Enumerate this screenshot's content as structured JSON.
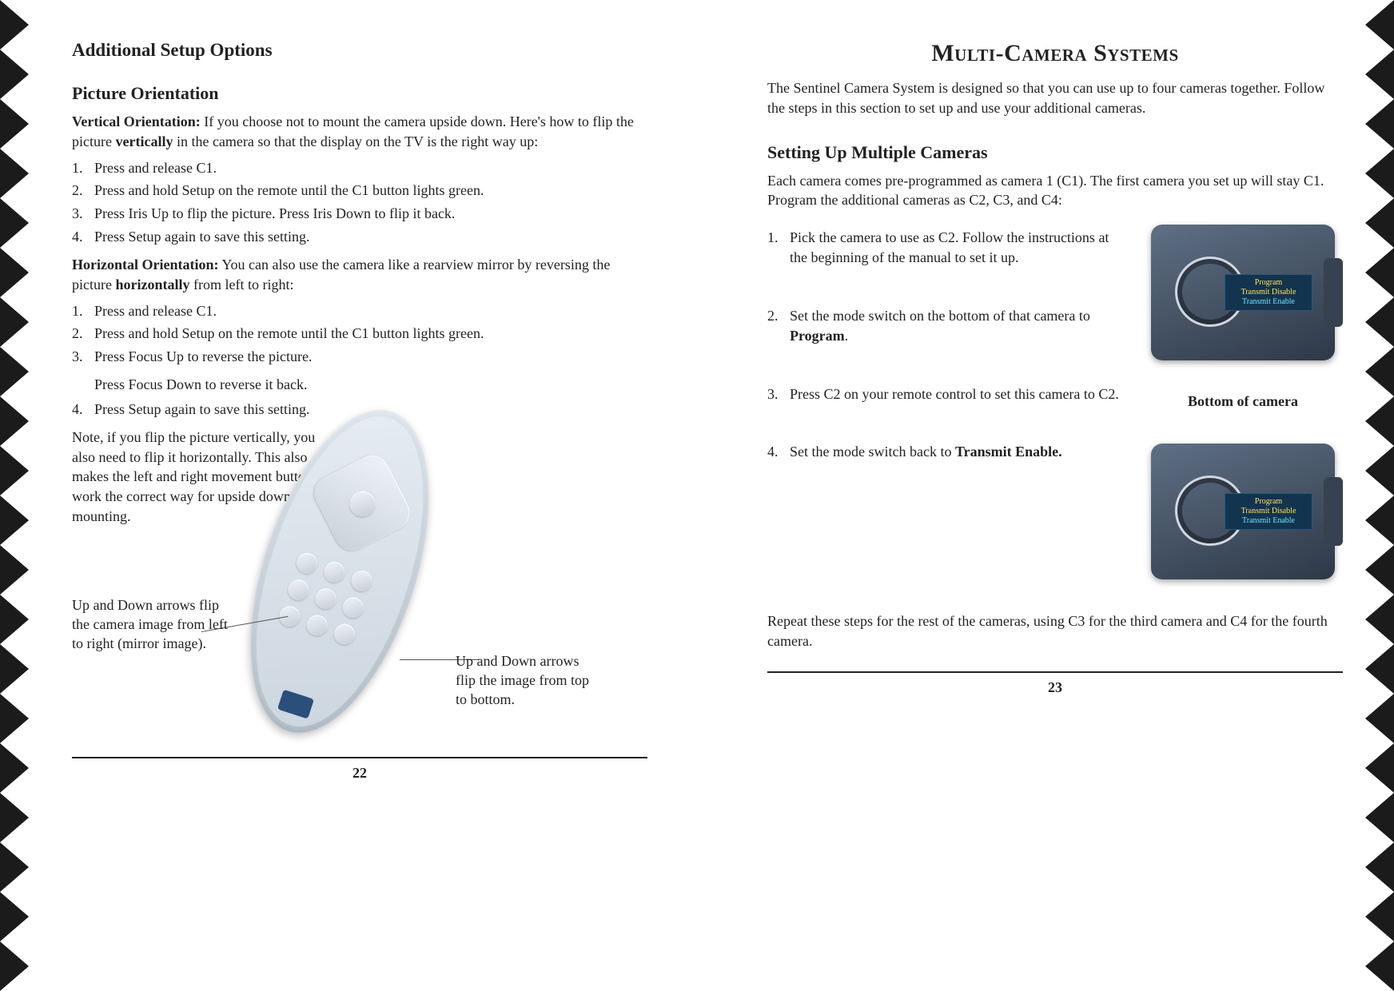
{
  "left": {
    "h1": "Additional Setup Options",
    "h2": "Picture Orientation",
    "vertical_lead": "Vertical Orientation:",
    "vertical_body": " If you choose not to mount the camera upside down. Here's how to flip the picture ",
    "vertical_bold": "vertically",
    "vertical_tail": " in the camera so that the display on the TV is the right way up:",
    "v_steps": [
      "Press and release C1.",
      "Press and hold Setup on the remote until the C1 button lights green.",
      "Press Iris Up to flip the picture. Press Iris Down to flip it back.",
      "Press Setup again to save this setting."
    ],
    "horizontal_lead": "Horizontal Orientation:",
    "horizontal_body": " You can also use the camera like a rearview mirror by reversing the picture ",
    "horizontal_bold": "horizontally",
    "horizontal_tail": " from left to right:",
    "h_steps": [
      "Press and release C1.",
      "Press and hold Setup on the remote until the C1 button lights green.",
      "Press Focus Up to reverse the picture.",
      "Press Setup again to save this setting."
    ],
    "h_step3_sub": "Press Focus Down to reverse it back.",
    "note": "Note, if you flip the picture vertically, you also need to flip it horizontally. This also makes the left and right movement buttons work the correct way for upside down mounting.",
    "caption_left": "Up and Down arrows flip the camera image from left to right (mirror image).",
    "caption_right": "Up and Down arrows flip the image from top to bottom.",
    "pagenum": "22"
  },
  "right": {
    "title": "Multi-Camera Systems",
    "intro": "The Sentinel Camera System is designed so that you can use up to four cameras together. Follow the steps in this section to set up and use your additional cameras.",
    "h2": "Setting Up Multiple Cameras",
    "lead": "Each camera comes pre-programmed as camera 1 (C1). The first camera you set up will stay C1. Program the additional cameras as C2, C3, and C4:",
    "steps": [
      "Pick the camera to use as C2. Follow the instructions at the beginning of the manual to set it up.",
      "Set the mode switch on the bottom of that camera to ",
      "Press C2 on your remote control to set this camera to C2.",
      "Set the mode switch back to "
    ],
    "step2_bold": "Program",
    "step4_bold": "Transmit Enable.",
    "cam_caption": "Bottom of camera",
    "cam_label_program": "Program",
    "cam_label_disable": "Transmit Disable",
    "cam_label_enable": "Transmit Enable",
    "closing": "Repeat these steps for the rest of the cameras, using C3 for the third camera and C4 for the fourth camera.",
    "pagenum": "23"
  }
}
